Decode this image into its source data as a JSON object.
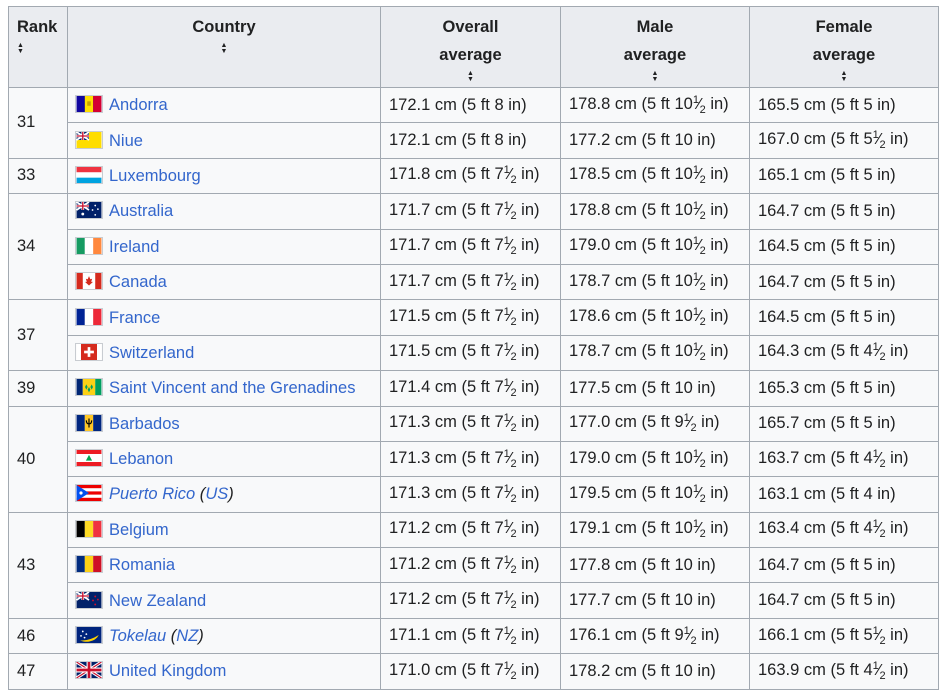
{
  "headers": {
    "rank": "Rank",
    "country": "Country",
    "overall": [
      "Overall",
      "average"
    ],
    "male": [
      "Male",
      "average"
    ],
    "female": [
      "Female",
      "average"
    ]
  },
  "rows": [
    {
      "rank": "31",
      "rowspan": 2,
      "country": "Andorra",
      "flag": "andorra",
      "overall": "172.1 cm (5 ft 8 in)",
      "male": "178.8 cm (5 ft 10½ in)",
      "female": "165.5 cm (5 ft 5 in)"
    },
    {
      "country": "Niue",
      "flag": "niue",
      "overall": "172.1 cm (5 ft 8 in)",
      "male": "177.2 cm (5 ft 10 in)",
      "female": "167.0 cm (5 ft 5½ in)"
    },
    {
      "rank": "33",
      "rowspan": 1,
      "country": "Luxembourg",
      "flag": "luxembourg",
      "overall": "171.8 cm (5 ft 7½ in)",
      "male": "178.5 cm (5 ft 10½ in)",
      "female": "165.1 cm (5 ft 5 in)"
    },
    {
      "rank": "34",
      "rowspan": 3,
      "country": "Australia",
      "flag": "australia",
      "overall": "171.7 cm (5 ft 7½ in)",
      "male": "178.8 cm (5 ft 10½ in)",
      "female": "164.7 cm (5 ft 5 in)"
    },
    {
      "country": "Ireland",
      "flag": "ireland",
      "overall": "171.7 cm (5 ft 7½ in)",
      "male": "179.0 cm (5 ft 10½ in)",
      "female": "164.5 cm (5 ft 5 in)"
    },
    {
      "country": "Canada",
      "flag": "canada",
      "overall": "171.7 cm (5 ft 7½ in)",
      "male": "178.7 cm (5 ft 10½ in)",
      "female": "164.7 cm (5 ft 5 in)"
    },
    {
      "rank": "37",
      "rowspan": 2,
      "country": "France",
      "flag": "france",
      "overall": "171.5 cm (5 ft 7½ in)",
      "male": "178.6 cm (5 ft 10½ in)",
      "female": "164.5 cm (5 ft 5 in)"
    },
    {
      "country": "Switzerland",
      "flag": "switzerland",
      "overall": "171.5 cm (5 ft 7½ in)",
      "male": "178.7 cm (5 ft 10½ in)",
      "female": "164.3 cm (5 ft 4½ in)"
    },
    {
      "rank": "39",
      "rowspan": 1,
      "country": "Saint Vincent and the Grenadines",
      "flag": "svg",
      "overall": "171.4 cm (5 ft 7½ in)",
      "male": "177.5 cm (5 ft 10 in)",
      "female": "165.3 cm (5 ft 5 in)"
    },
    {
      "rank": "40",
      "rowspan": 3,
      "country": "Barbados",
      "flag": "barbados",
      "overall": "171.3 cm (5 ft 7½ in)",
      "male": "177.0 cm (5 ft 9½ in)",
      "female": "165.7 cm (5 ft 5 in)"
    },
    {
      "country": "Lebanon",
      "flag": "lebanon",
      "overall": "171.3 cm (5 ft 7½ in)",
      "male": "179.0 cm (5 ft 10½ in)",
      "female": "163.7 cm (5 ft 4½ in)"
    },
    {
      "country": "Puerto Rico",
      "italic": true,
      "sov": "US",
      "flag": "puertorico",
      "overall": "171.3 cm (5 ft 7½ in)",
      "male": "179.5 cm (5 ft 10½ in)",
      "female": "163.1 cm (5 ft 4 in)"
    },
    {
      "rank": "43",
      "rowspan": 3,
      "country": "Belgium",
      "flag": "belgium",
      "overall": "171.2 cm (5 ft 7½ in)",
      "male": "179.1 cm (5 ft 10½ in)",
      "female": "163.4 cm (5 ft 4½ in)"
    },
    {
      "country": "Romania",
      "flag": "romania",
      "overall": "171.2 cm (5 ft 7½ in)",
      "male": "177.8 cm (5 ft 10 in)",
      "female": "164.7 cm (5 ft 5 in)"
    },
    {
      "country": "New Zealand",
      "flag": "newzealand",
      "overall": "171.2 cm (5 ft 7½ in)",
      "male": "177.7 cm (5 ft 10 in)",
      "female": "164.7 cm (5 ft 5 in)"
    },
    {
      "rank": "46",
      "rowspan": 1,
      "country": "Tokelau",
      "italic": true,
      "sov": "NZ",
      "flag": "tokelau",
      "overall": "171.1 cm (5 ft 7½ in)",
      "male": "176.1 cm (5 ft 9½ in)",
      "female": "166.1 cm (5 ft 5½ in)"
    },
    {
      "rank": "47",
      "rowspan": 1,
      "country": "United Kingdom",
      "flag": "uk",
      "overall": "171.0 cm (5 ft 7½ in)",
      "male": "178.2 cm (5 ft 10 in)",
      "female": "163.9 cm (5 ft 4½ in)"
    }
  ]
}
